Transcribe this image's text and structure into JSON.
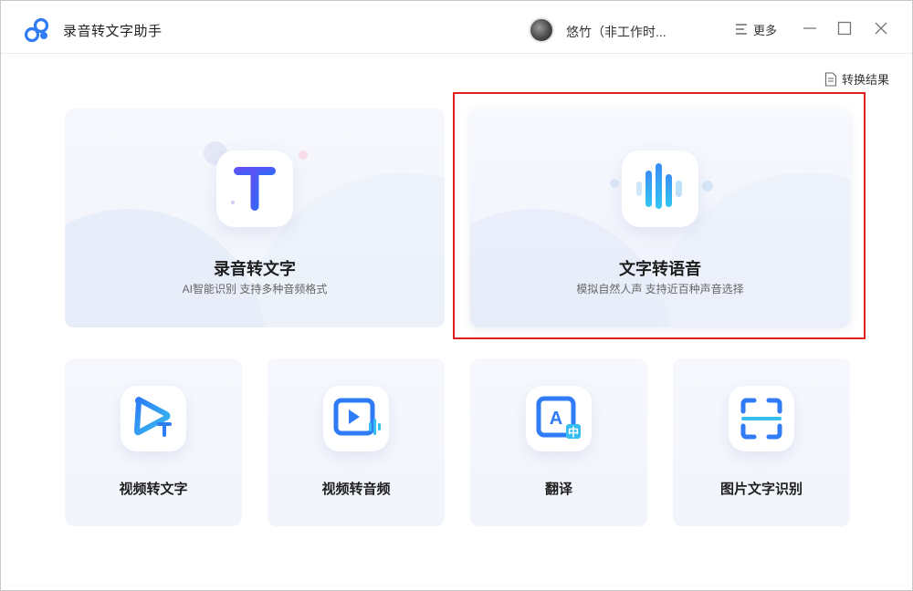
{
  "app": {
    "title": "录音转文字助手",
    "logo_icon": "cloud-link-logo-icon",
    "accent_color": "#2f7cf6"
  },
  "user": {
    "name": "悠竹（非工作时...",
    "avatar_icon": "user-avatar"
  },
  "toolbar": {
    "more_label": "更多",
    "more_icon": "menu-lines-icon",
    "minimize_icon": "minimize-icon",
    "maximize_icon": "maximize-icon",
    "close_icon": "close-icon"
  },
  "results_link": {
    "label": "转换结果",
    "icon": "document-icon"
  },
  "feature_cards": [
    {
      "title": "录音转文字",
      "subtitle": "AI智能识别 支持多种音频格式",
      "icon": "text-t-icon"
    },
    {
      "title": "文字转语音",
      "subtitle": "模拟自然人声 支持近百种声音选择",
      "icon": "sound-wave-icon",
      "highlighted": true,
      "highlight_color": "#e02020"
    }
  ],
  "tool_cards": [
    {
      "title": "视频转文字",
      "icon": "video-to-text-icon"
    },
    {
      "title": "视频转音频",
      "icon": "video-to-audio-icon"
    },
    {
      "title": "翻译",
      "icon": "translate-icon"
    },
    {
      "title": "图片文字识别",
      "icon": "scan-ocr-icon"
    }
  ]
}
